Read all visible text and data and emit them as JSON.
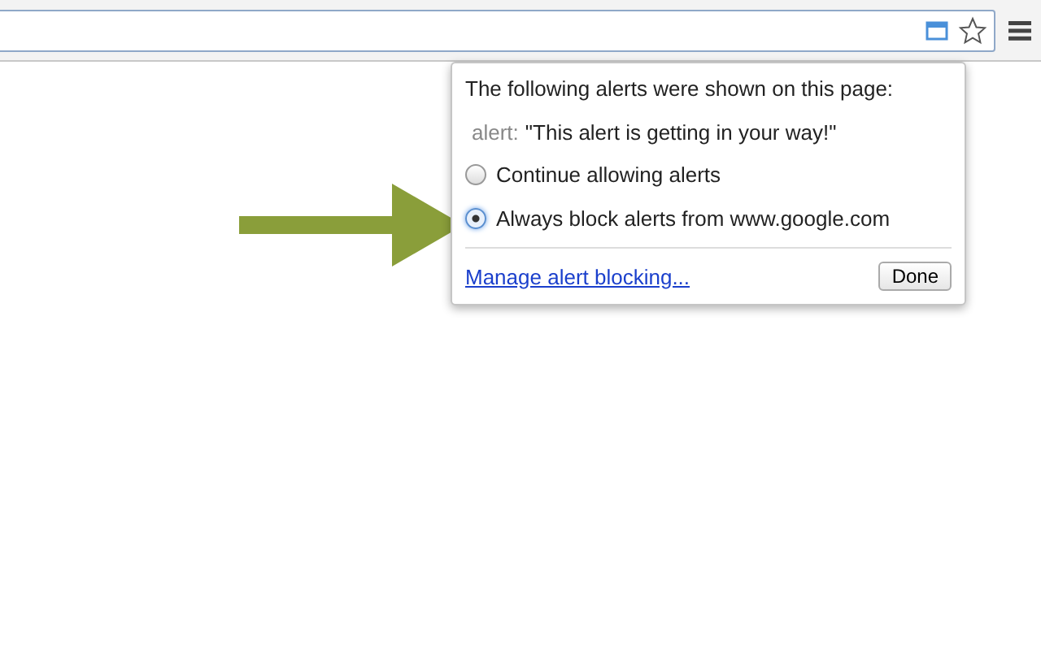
{
  "popup": {
    "heading": "The following alerts were shown on this page:",
    "alert_label": "alert:",
    "alert_message": "\"This alert is getting in your way!\"",
    "options": [
      {
        "label": "Continue allowing alerts",
        "selected": false
      },
      {
        "label": "Always block alerts from www.google.com",
        "selected": true
      }
    ],
    "manage_link": "Manage alert blocking...",
    "done_button": "Done"
  }
}
